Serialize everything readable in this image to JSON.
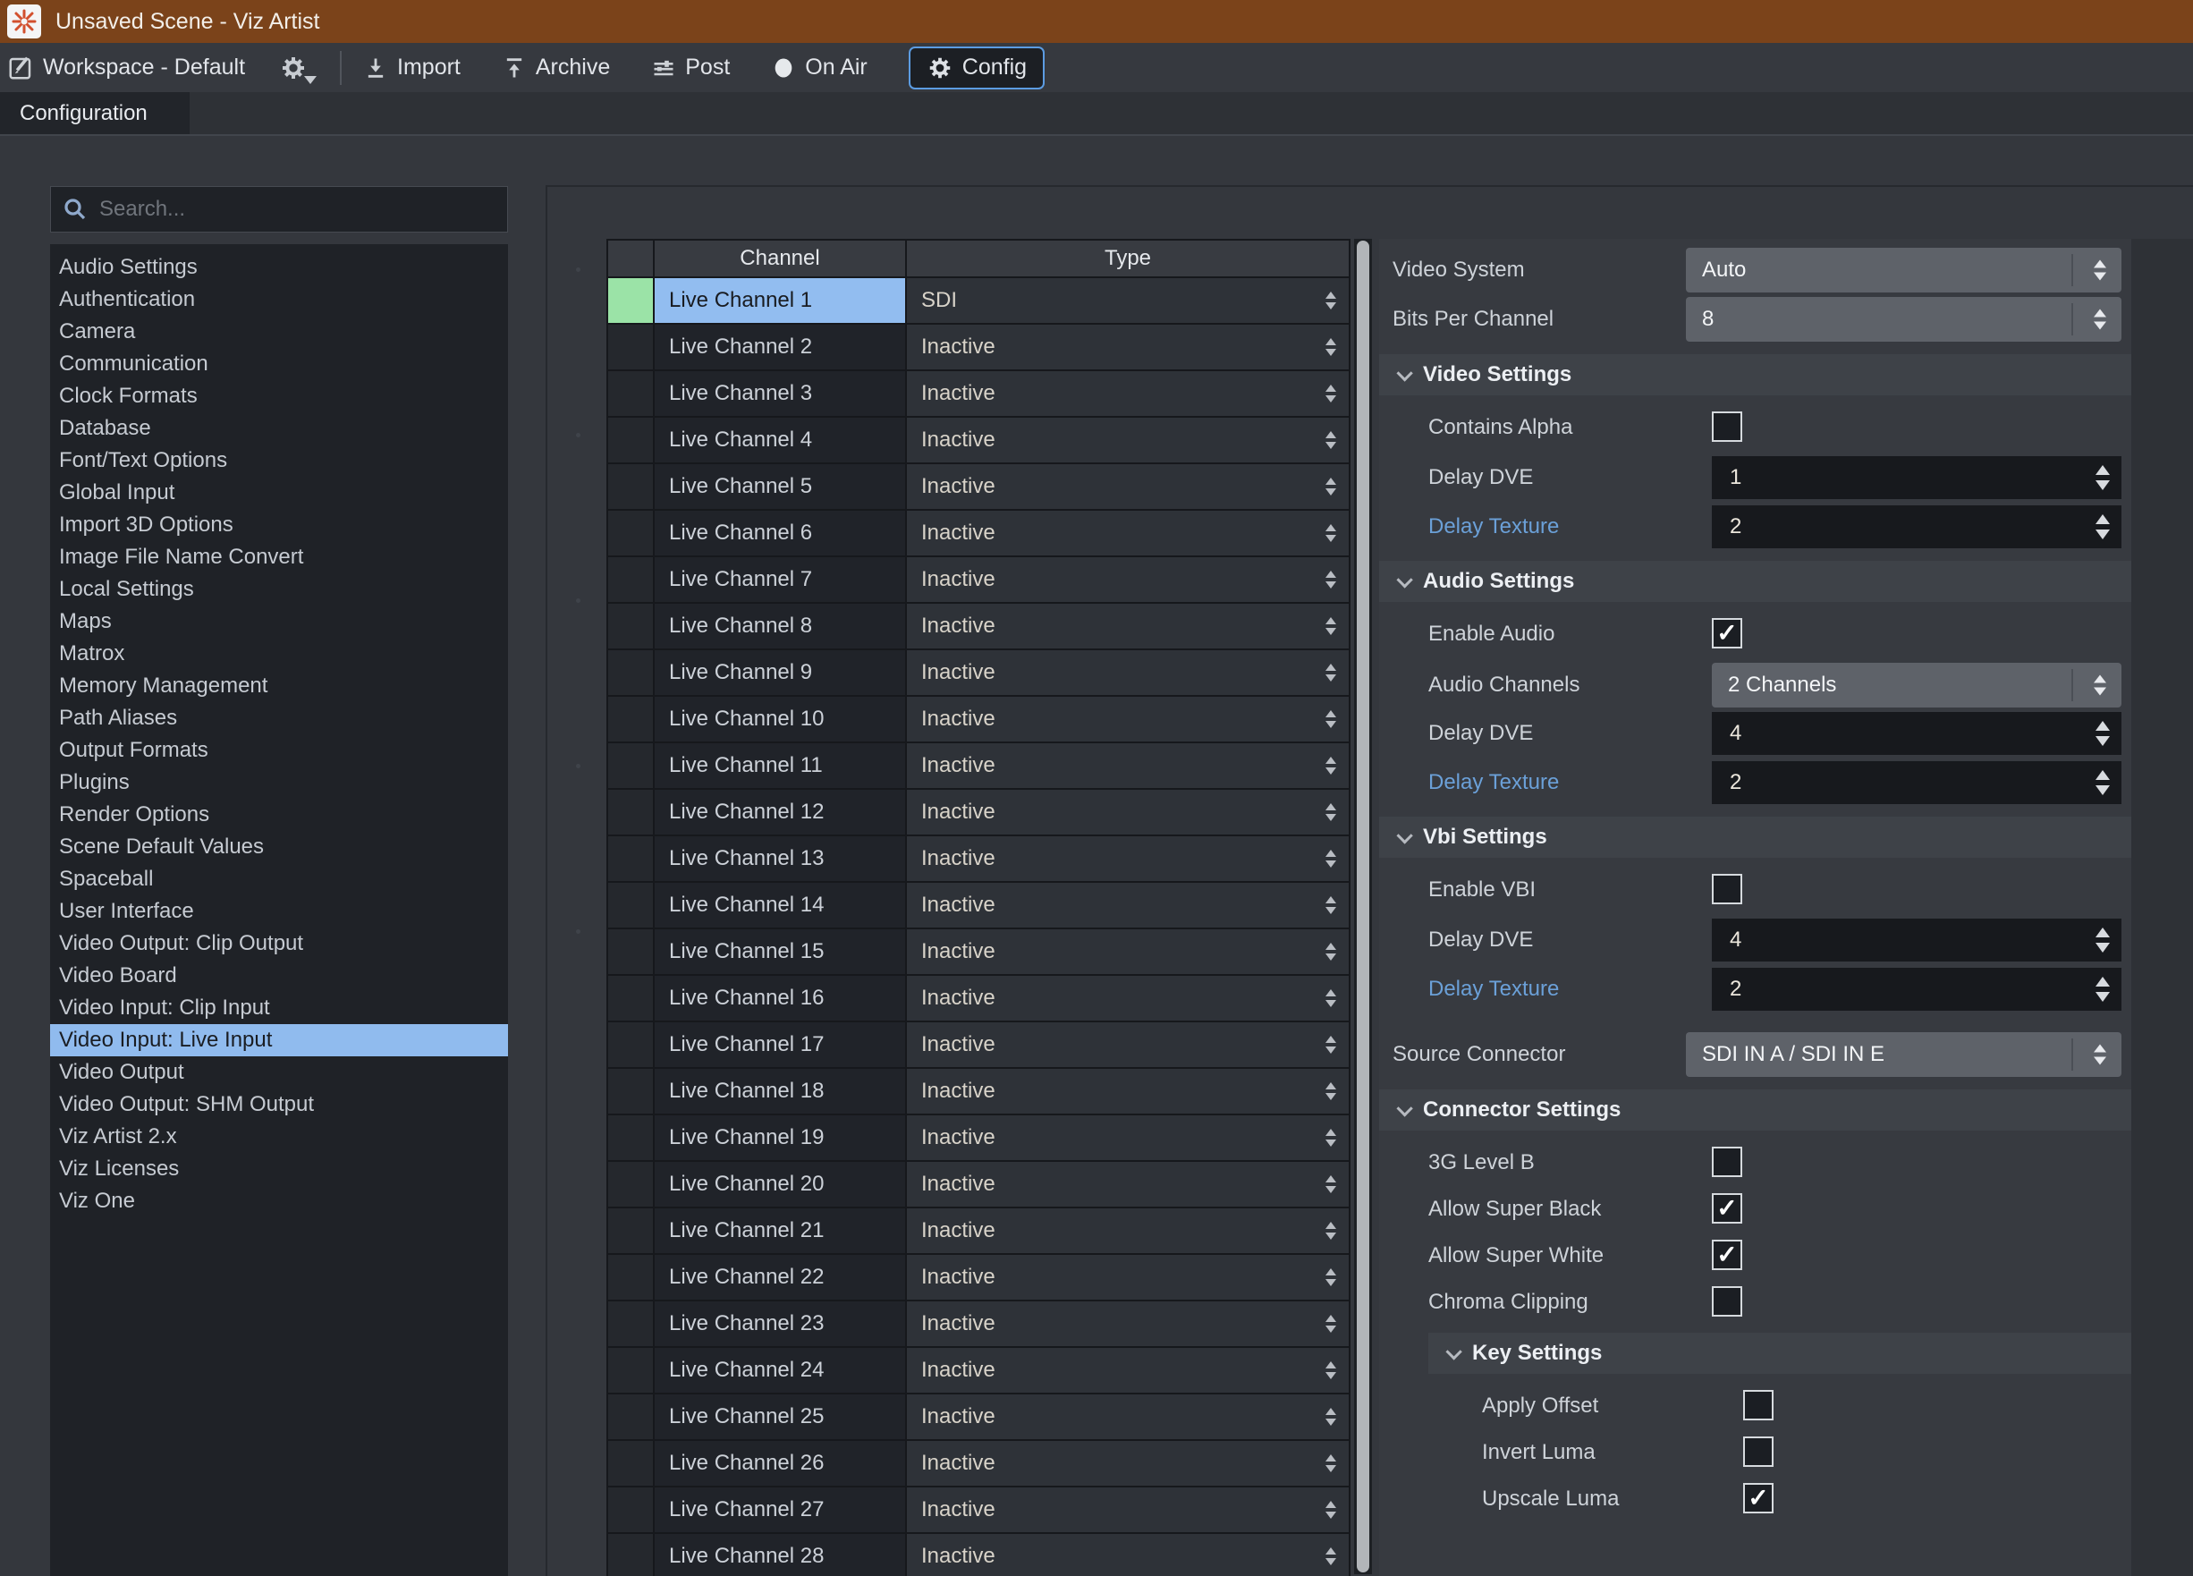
{
  "window": {
    "title": "Unsaved Scene - Viz Artist"
  },
  "toolbar": {
    "workspace": {
      "label": "Workspace - Default"
    },
    "buttons": [
      {
        "label": "Import",
        "icon": "import-icon"
      },
      {
        "label": "Archive",
        "icon": "archive-icon"
      },
      {
        "label": "Post",
        "icon": "post-icon"
      },
      {
        "label": "On Air",
        "icon": "on-air-icon"
      },
      {
        "label": "Config",
        "icon": "config-gear-icon",
        "active": true
      }
    ]
  },
  "tabs": [
    {
      "label": "Configuration",
      "active": true
    }
  ],
  "sidebar": {
    "search": {
      "placeholder": "Search...",
      "value": ""
    },
    "items": [
      {
        "label": "Audio Settings"
      },
      {
        "label": "Authentication"
      },
      {
        "label": "Camera"
      },
      {
        "label": "Communication"
      },
      {
        "label": "Clock Formats"
      },
      {
        "label": "Database"
      },
      {
        "label": "Font/Text Options"
      },
      {
        "label": "Global Input"
      },
      {
        "label": "Import 3D Options"
      },
      {
        "label": "Image File Name Convert"
      },
      {
        "label": "Local Settings"
      },
      {
        "label": "Maps"
      },
      {
        "label": "Matrox"
      },
      {
        "label": "Memory Management"
      },
      {
        "label": "Path Aliases"
      },
      {
        "label": "Output Formats"
      },
      {
        "label": "Plugins"
      },
      {
        "label": "Render Options"
      },
      {
        "label": "Scene Default Values"
      },
      {
        "label": "Spaceball"
      },
      {
        "label": "User Interface"
      },
      {
        "label": "Video Output: Clip Output"
      },
      {
        "label": "Video Board"
      },
      {
        "label": "Video Input: Clip Input"
      },
      {
        "label": "Video Input: Live Input",
        "selected": true
      },
      {
        "label": "Video Output"
      },
      {
        "label": "Video Output: SHM Output"
      },
      {
        "label": "Viz Artist 2.x"
      },
      {
        "label": "Viz Licenses"
      },
      {
        "label": "Viz One"
      }
    ]
  },
  "channel_table": {
    "columns": {
      "channel": "Channel",
      "type": "Type"
    },
    "rows": [
      {
        "channel": "Live Channel 1",
        "type": "SDI",
        "selected": true,
        "active": true
      },
      {
        "channel": "Live Channel 2",
        "type": "Inactive"
      },
      {
        "channel": "Live Channel 3",
        "type": "Inactive"
      },
      {
        "channel": "Live Channel 4",
        "type": "Inactive"
      },
      {
        "channel": "Live Channel 5",
        "type": "Inactive"
      },
      {
        "channel": "Live Channel 6",
        "type": "Inactive"
      },
      {
        "channel": "Live Channel 7",
        "type": "Inactive"
      },
      {
        "channel": "Live Channel 8",
        "type": "Inactive"
      },
      {
        "channel": "Live Channel 9",
        "type": "Inactive"
      },
      {
        "channel": "Live Channel 10",
        "type": "Inactive"
      },
      {
        "channel": "Live Channel 11",
        "type": "Inactive"
      },
      {
        "channel": "Live Channel 12",
        "type": "Inactive"
      },
      {
        "channel": "Live Channel 13",
        "type": "Inactive"
      },
      {
        "channel": "Live Channel 14",
        "type": "Inactive"
      },
      {
        "channel": "Live Channel 15",
        "type": "Inactive"
      },
      {
        "channel": "Live Channel 16",
        "type": "Inactive"
      },
      {
        "channel": "Live Channel 17",
        "type": "Inactive"
      },
      {
        "channel": "Live Channel 18",
        "type": "Inactive"
      },
      {
        "channel": "Live Channel 19",
        "type": "Inactive"
      },
      {
        "channel": "Live Channel 20",
        "type": "Inactive"
      },
      {
        "channel": "Live Channel 21",
        "type": "Inactive"
      },
      {
        "channel": "Live Channel 22",
        "type": "Inactive"
      },
      {
        "channel": "Live Channel 23",
        "type": "Inactive"
      },
      {
        "channel": "Live Channel 24",
        "type": "Inactive"
      },
      {
        "channel": "Live Channel 25",
        "type": "Inactive"
      },
      {
        "channel": "Live Channel 26",
        "type": "Inactive"
      },
      {
        "channel": "Live Channel 27",
        "type": "Inactive"
      },
      {
        "channel": "Live Channel 28",
        "type": "Inactive"
      }
    ]
  },
  "settings_panel": {
    "rows": [
      {
        "kind": "dropdown",
        "label": "Video System",
        "value": "Auto",
        "indent": 0
      },
      {
        "kind": "dropdown",
        "label": "Bits Per Channel",
        "value": "8",
        "indent": 0
      },
      {
        "kind": "section",
        "label": "Video Settings",
        "indent": 0
      },
      {
        "kind": "checkbox",
        "label": "Contains Alpha",
        "checked": false,
        "indent": 1
      },
      {
        "kind": "spinner",
        "label": "Delay DVE",
        "value": "1",
        "indent": 1
      },
      {
        "kind": "spinner",
        "label": "Delay Texture",
        "value": "2",
        "indent": 1,
        "label_color": "blue"
      },
      {
        "kind": "section",
        "label": "Audio Settings",
        "indent": 0
      },
      {
        "kind": "checkbox",
        "label": "Enable Audio",
        "checked": true,
        "indent": 1
      },
      {
        "kind": "dropdown",
        "label": "Audio Channels",
        "value": "2 Channels",
        "indent": 1
      },
      {
        "kind": "spinner",
        "label": "Delay DVE",
        "value": "4",
        "indent": 1
      },
      {
        "kind": "spinner",
        "label": "Delay Texture",
        "value": "2",
        "indent": 1,
        "label_color": "blue"
      },
      {
        "kind": "section",
        "label": "Vbi Settings",
        "indent": 0
      },
      {
        "kind": "checkbox",
        "label": "Enable VBI",
        "checked": false,
        "indent": 1
      },
      {
        "kind": "spinner",
        "label": "Delay DVE",
        "value": "4",
        "indent": 1
      },
      {
        "kind": "spinner",
        "label": "Delay Texture",
        "value": "2",
        "indent": 1,
        "label_color": "blue"
      },
      {
        "kind": "dropdown",
        "label": "Source Connector",
        "value": "SDI IN A / SDI IN E",
        "indent": 0,
        "gap_top": true
      },
      {
        "kind": "section",
        "label": "Connector Settings",
        "indent": 0
      },
      {
        "kind": "checkbox",
        "label": "3G Level B",
        "checked": false,
        "indent": 1
      },
      {
        "kind": "checkbox",
        "label": "Allow Super Black",
        "checked": true,
        "indent": 1
      },
      {
        "kind": "checkbox",
        "label": "Allow Super White",
        "checked": true,
        "indent": 1
      },
      {
        "kind": "checkbox",
        "label": "Chroma Clipping",
        "checked": false,
        "indent": 1
      },
      {
        "kind": "section",
        "label": "Key Settings",
        "indent": 1
      },
      {
        "kind": "checkbox",
        "label": "Apply Offset",
        "checked": false,
        "indent": 2
      },
      {
        "kind": "checkbox",
        "label": "Invert Luma",
        "checked": false,
        "indent": 2
      },
      {
        "kind": "checkbox",
        "label": "Upscale Luma",
        "checked": true,
        "indent": 2
      }
    ]
  },
  "colors": {
    "titlebar_brown": "#7b431a",
    "selection_blue": "#90bbee",
    "active_green": "#9be3a7",
    "config_button_border": "#5c9ce2",
    "link_label_blue": "#6ba0d8",
    "logo_red": "#d2502e"
  }
}
